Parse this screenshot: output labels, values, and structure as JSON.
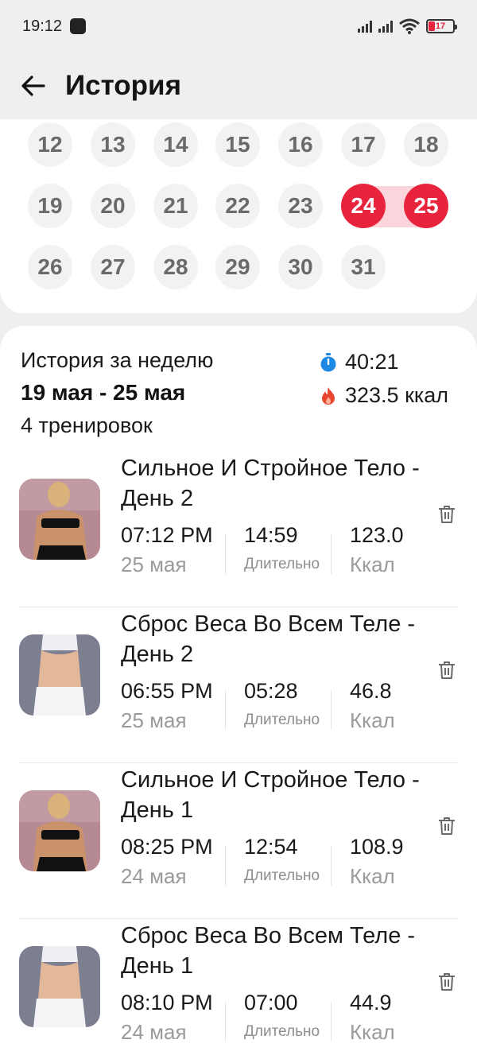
{
  "status_bar": {
    "time": "19:12",
    "battery": "17",
    "icons": [
      "app-notification-icon",
      "signal-icon",
      "signal-icon",
      "wifi-icon",
      "battery-icon"
    ]
  },
  "header": {
    "title": "История",
    "back_icon": "arrow-left-icon"
  },
  "calendar": {
    "rows": [
      [
        "12",
        "13",
        "14",
        "15",
        "16",
        "17",
        "18"
      ],
      [
        "19",
        "20",
        "21",
        "22",
        "23",
        "24",
        "25"
      ],
      [
        "26",
        "27",
        "28",
        "29",
        "30",
        "31"
      ]
    ],
    "selected": [
      "24",
      "25"
    ],
    "accent_color": "#e8233c",
    "range_color": "#fbd5db"
  },
  "summary": {
    "label": "История за неделю",
    "range": "19 мая - 25 мая",
    "count": "4 тренировок",
    "total_time": "40:21",
    "total_kcal": "323.5 ккал",
    "time_icon": "stopwatch-icon",
    "kcal_icon": "flame-icon"
  },
  "workouts": [
    {
      "title": "Сильное И Стройное Тело - День 2",
      "start": "07:12 PM",
      "date": "25 мая",
      "duration": "14:59",
      "duration_label": "Длительно",
      "kcal": "123.0",
      "kcal_label": "Ккал",
      "thumb": "back-muscles-photo"
    },
    {
      "title": "Сброс Веса Во Всем Теле - День 2",
      "start": "06:55 PM",
      "date": "25 мая",
      "duration": "05:28",
      "duration_label": "Длительно",
      "kcal": "46.8",
      "kcal_label": "Ккал",
      "thumb": "waist-photo"
    },
    {
      "title": "Сильное И Стройное Тело - День 1",
      "start": "08:25 PM",
      "date": "24 мая",
      "duration": "12:54",
      "duration_label": "Длительно",
      "kcal": "108.9",
      "kcal_label": "Ккал",
      "thumb": "back-muscles-photo"
    },
    {
      "title": "Сброс Веса Во Всем Теле - День 1",
      "start": "08:10 PM",
      "date": "24 мая",
      "duration": "07:00",
      "duration_label": "Длительно",
      "kcal": "44.9",
      "kcal_label": "Ккал",
      "thumb": "waist-photo"
    }
  ]
}
